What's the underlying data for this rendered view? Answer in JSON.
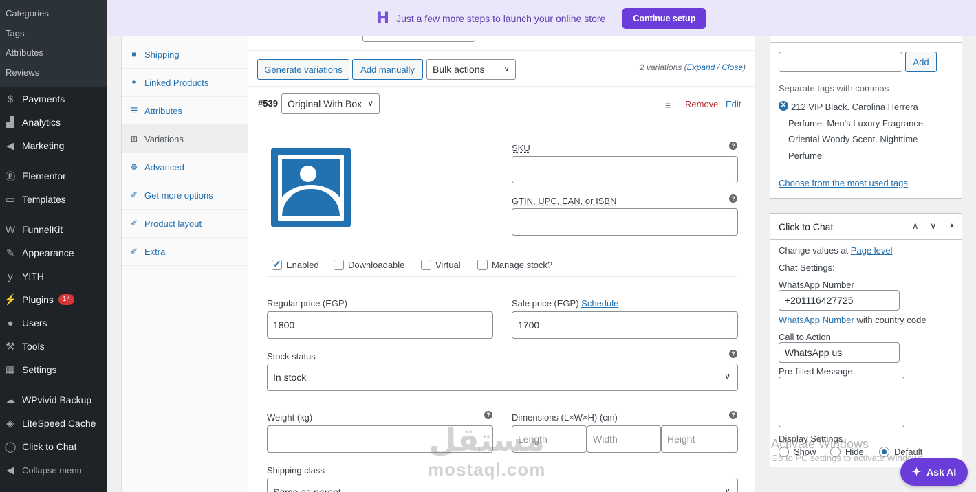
{
  "admin_menu": {
    "submenu": [
      "Categories",
      "Tags",
      "Attributes",
      "Reviews"
    ],
    "items": [
      {
        "label": "Payments",
        "icon": "payments-icon",
        "glyph": "$"
      },
      {
        "label": "Analytics",
        "icon": "analytics-icon",
        "glyph": "▟"
      },
      {
        "label": "Marketing",
        "icon": "marketing-icon",
        "glyph": "◀"
      },
      {
        "label": "Elementor",
        "icon": "elementor-icon",
        "glyph": "Ⓔ"
      },
      {
        "label": "Templates",
        "icon": "templates-icon",
        "glyph": "▭"
      },
      {
        "label": "FunnelKit",
        "icon": "funnelkit-icon",
        "glyph": "W"
      },
      {
        "label": "Appearance",
        "icon": "appearance-icon",
        "glyph": "✎"
      },
      {
        "label": "YITH",
        "icon": "yith-icon",
        "glyph": "y"
      },
      {
        "label": "Plugins",
        "icon": "plugins-icon",
        "glyph": "⚡",
        "badge": "14"
      },
      {
        "label": "Users",
        "icon": "users-icon",
        "glyph": "●"
      },
      {
        "label": "Tools",
        "icon": "tools-icon",
        "glyph": "⚒"
      },
      {
        "label": "Settings",
        "icon": "settings-icon",
        "glyph": "▦"
      },
      {
        "label": "WPvivid Backup",
        "icon": "cloud-icon",
        "glyph": "☁"
      },
      {
        "label": "LiteSpeed Cache",
        "icon": "litespeed-icon",
        "glyph": "◈"
      },
      {
        "label": "Click to Chat",
        "icon": "whatsapp-icon",
        "glyph": "◯"
      }
    ],
    "collapse_label": "Collapse menu"
  },
  "banner": {
    "logo": "H",
    "message": "Just a few more steps to launch your online store",
    "button": "Continue setup"
  },
  "product_tabs": [
    {
      "label": "Shipping",
      "icon": "truck-icon",
      "glyph": "■"
    },
    {
      "label": "Linked Products",
      "icon": "link-icon",
      "glyph": "⚭"
    },
    {
      "label": "Attributes",
      "icon": "list-icon",
      "glyph": "☰"
    },
    {
      "label": "Variations",
      "icon": "grid-icon",
      "glyph": "⊞",
      "active": true
    },
    {
      "label": "Advanced",
      "icon": "gear-icon",
      "glyph": "⚙"
    },
    {
      "label": "Get more options",
      "icon": "plugin-icon",
      "glyph": "✐"
    },
    {
      "label": "Product layout",
      "icon": "wrench-icon",
      "glyph": "✐"
    },
    {
      "label": "Extra",
      "icon": "wrench-icon",
      "glyph": "✐"
    }
  ],
  "toolbar": {
    "generate": "Generate variations",
    "add_manually": "Add manually",
    "bulk_actions": "Bulk actions",
    "count_text": "2 variations (",
    "expand": "Expand",
    "sep": " / ",
    "close": "Close",
    "count_end": ")"
  },
  "variation": {
    "id": "#539",
    "option": "Original With Box",
    "remove": "Remove",
    "edit": "Edit",
    "sku_label": "SKU",
    "sku_value": "",
    "gtin_label": "GTIN, UPC, EAN, or ISBN",
    "gtin_value": "",
    "enabled": "Enabled",
    "downloadable": "Downloadable",
    "virtual": "Virtual",
    "manage_stock": "Manage stock?",
    "regular_label": "Regular price (EGP)",
    "regular_value": "1800",
    "sale_label": "Sale price (EGP)",
    "schedule": "Schedule",
    "sale_value": "1700",
    "stock_label": "Stock status",
    "stock_value": "In stock",
    "weight_label": "Weight (kg)",
    "dims_label": "Dimensions (L×W×H) (cm)",
    "length_ph": "Length",
    "width_ph": "Width",
    "height_ph": "Height",
    "shipping_label": "Shipping class",
    "shipping_value": "Same as parent"
  },
  "tags_box": {
    "add": "Add",
    "hint": "Separate tags with commas",
    "tag_lines": [
      "212 VIP Black. Carolina Herrera",
      "Perfume. Men's Luxury Fragrance.",
      "Oriental Woody Scent. Nighttime",
      "Perfume"
    ],
    "choose_link": "Choose from the most used tags"
  },
  "chat_box": {
    "title": "Click to Chat",
    "change_values": "Change values at ",
    "page_level": "Page level",
    "chat_settings": "Chat Settings:",
    "whatsapp_label": "WhatsApp Number",
    "whatsapp_value": "+201116427725",
    "whatsapp_link": "WhatsApp Number",
    "country_code": " with country code",
    "cta_label": "Call to Action",
    "cta_value": "WhatsApp us",
    "prefilled_label": "Pre-filled Message",
    "display_label": "Display Settings",
    "show": "Show",
    "hide": "Hide",
    "default": "Default"
  },
  "watermark": {
    "line1": "Activate Windows",
    "line2": "Go to PC settings to activate Windows.",
    "mostaql_ar": "مستقل",
    "mostaql_en": "mostaql.com"
  },
  "ask_ai": "Ask AI"
}
